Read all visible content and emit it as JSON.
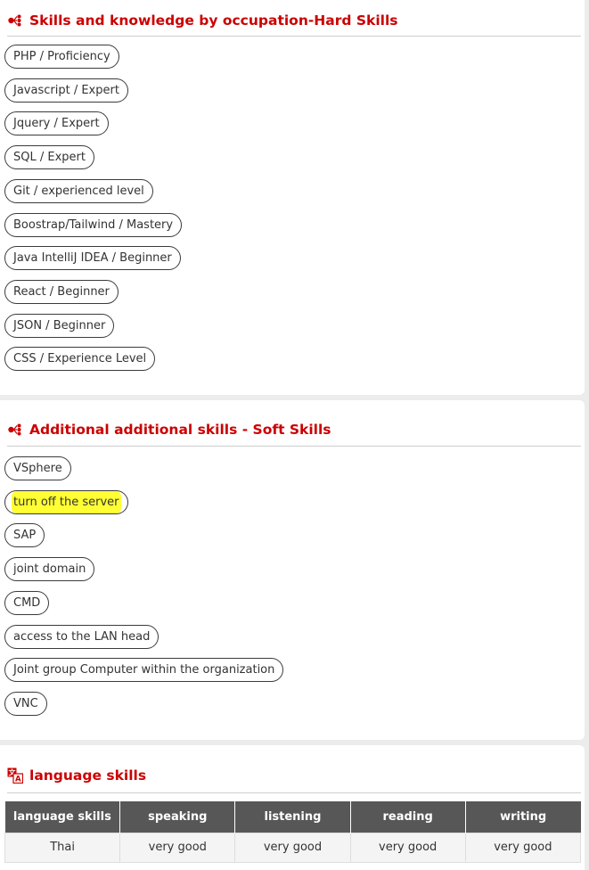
{
  "hard_skills": {
    "title": "Skills and knowledge by occupation-Hard Skills",
    "icon": "skills-tree-icon",
    "items": [
      "PHP / Proficiency",
      "Javascript / Expert",
      "Jquery / Expert",
      "SQL / Expert",
      "Git / experienced level",
      "Boostrap/Tailwind / Mastery",
      "Java IntelliJ IDEA / Beginner",
      "React / Beginner",
      "JSON / Beginner",
      "CSS / Experience Level"
    ]
  },
  "soft_skills": {
    "title": "Additional additional skills - Soft Skills",
    "icon": "skills-tree-icon",
    "items": [
      "VSphere",
      "turn off the server",
      "SAP",
      "joint domain",
      "CMD",
      "access to the LAN head",
      "Joint group Computer within the organization",
      "VNC"
    ],
    "highlight_color": "#ffff33"
  },
  "language_skills": {
    "title": "language skills",
    "icon": "translate-icon",
    "headers": [
      "language skills",
      "speaking",
      "listening",
      "reading",
      "writing"
    ],
    "rows": [
      [
        "Thai",
        "very good",
        "very good",
        "very good",
        "very good"
      ]
    ]
  },
  "colors": {
    "accent": "#cc0000",
    "table_header": "#575757"
  }
}
